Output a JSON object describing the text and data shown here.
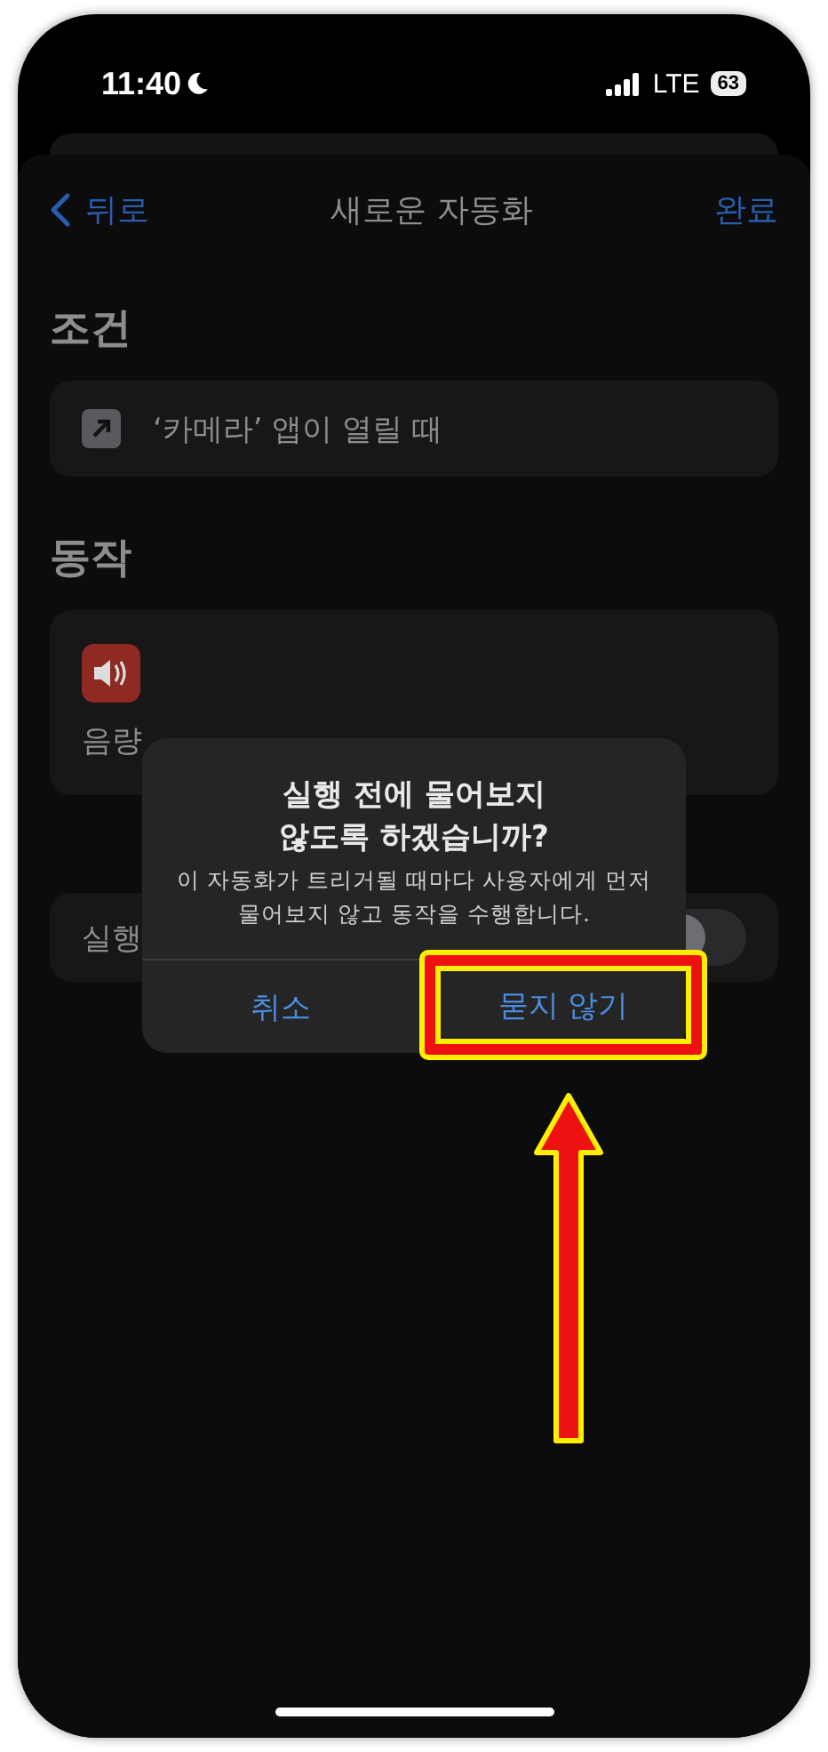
{
  "status_bar": {
    "time": "11:40",
    "network": "LTE",
    "battery": "63"
  },
  "nav": {
    "back": "뒤로",
    "title": "새로운 자동화",
    "done": "완료"
  },
  "sections": [
    {
      "heading": "조건",
      "rows": [
        {
          "kind": "trigger",
          "label": "‘카메라’ 앱이 열릴 때"
        }
      ]
    },
    {
      "heading": "동작",
      "rows": [
        {
          "kind": "action",
          "label": "음량"
        }
      ]
    }
  ],
  "run_row": {
    "label": "실행",
    "on": false
  },
  "dialog": {
    "title": "실행 전에 물어보지\n않도록 하겠습니까?",
    "message": "이 자동화가 트리거될 때마다 사용자에게 먼저\n물어보지 않고 동작을 수행합니다.",
    "buttons": [
      {
        "label": "취소",
        "highlighted": false
      },
      {
        "label": "묻지 않기",
        "highlighted": true
      }
    ]
  },
  "annotation": {
    "arrow": true
  }
}
